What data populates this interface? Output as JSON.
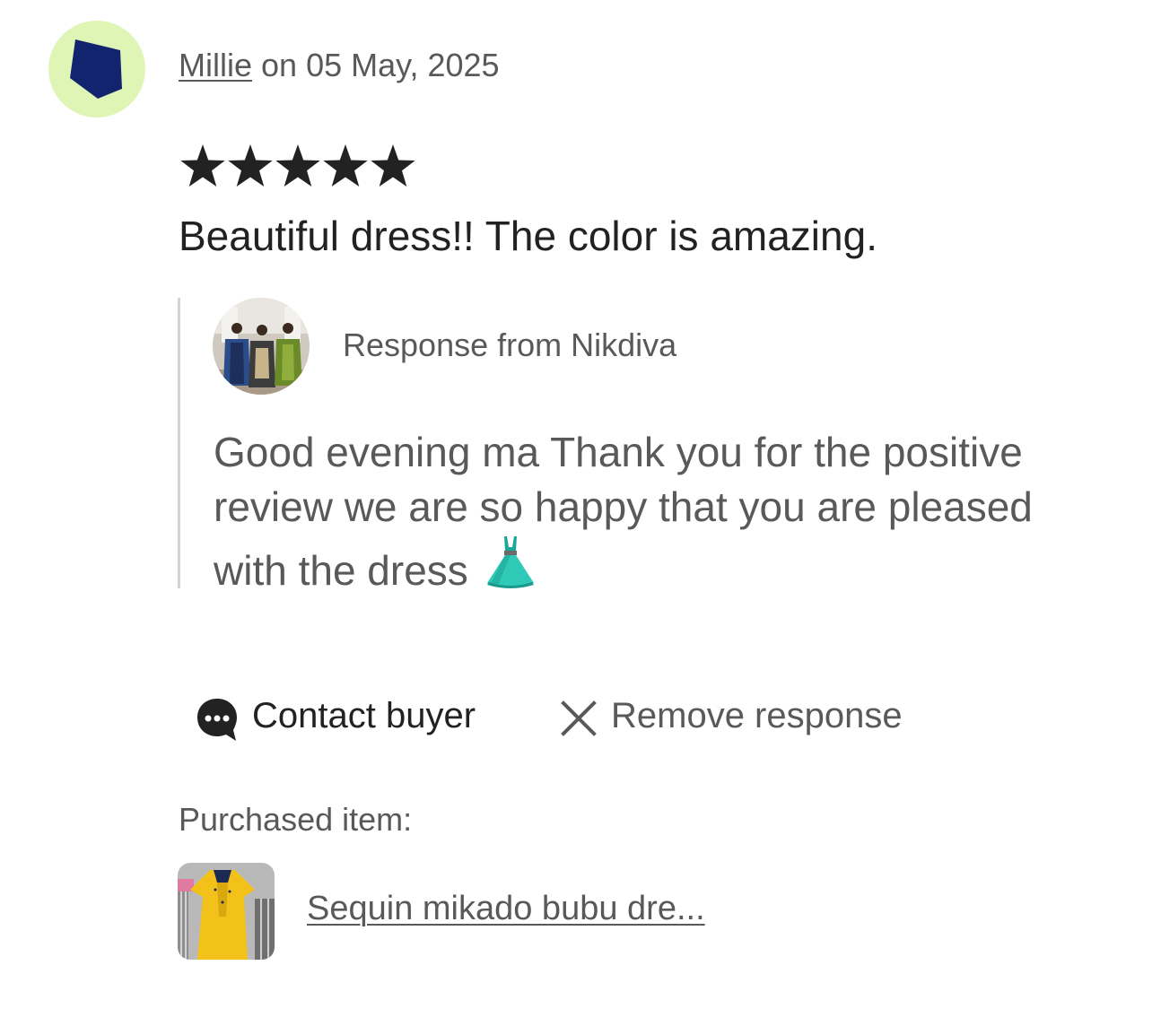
{
  "review": {
    "reviewer_name": "Millie",
    "date_text": " on 05 May, 2025",
    "rating": 5,
    "rating_max": 5,
    "text": "Beautiful dress!! The color is amazing.",
    "avatar_colors": {
      "background": "#dff5b5",
      "shape": "#13246e"
    }
  },
  "response": {
    "title": "Response from Nikdiva",
    "body": "Good evening ma Thank you for the positive review we are so happy that you are pleased with the dress",
    "emoji_icon": "dress-icon"
  },
  "actions": {
    "contact_label": "Contact buyer",
    "contact_icon": "chat-bubble-icon",
    "remove_label": "Remove response",
    "remove_icon": "close-icon"
  },
  "purchased": {
    "label": "Purchased item:",
    "item_title": "Sequin mikado bubu dre..."
  }
}
